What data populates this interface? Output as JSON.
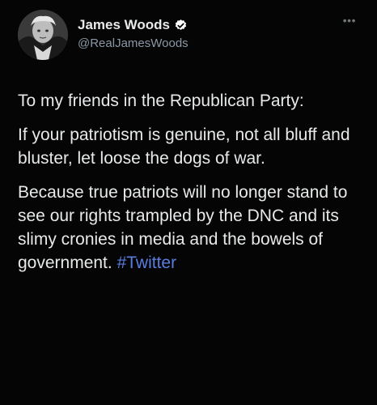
{
  "tweet": {
    "author": {
      "display_name": "James Woods",
      "handle": "@RealJamesWoods",
      "verified": true
    },
    "menu_icon": "more-horizontal-icon",
    "paragraphs": [
      "To my friends in the Republican Party:",
      "If your patriotism is genuine, not all bluff and bluster, let loose the dogs of war."
    ],
    "final_paragraph": {
      "text": "Because true patriots will no longer stand to see our rights trampled by the DNC and its slimy cronies in media and the bowels of government.",
      "hashtag": "#Twitter"
    }
  },
  "colors": {
    "background": "#000000",
    "text": "#e7e9ea",
    "secondary_text": "#8b98a5",
    "hashtag": "#5b7de0",
    "verified_badge": "#ffffff"
  }
}
